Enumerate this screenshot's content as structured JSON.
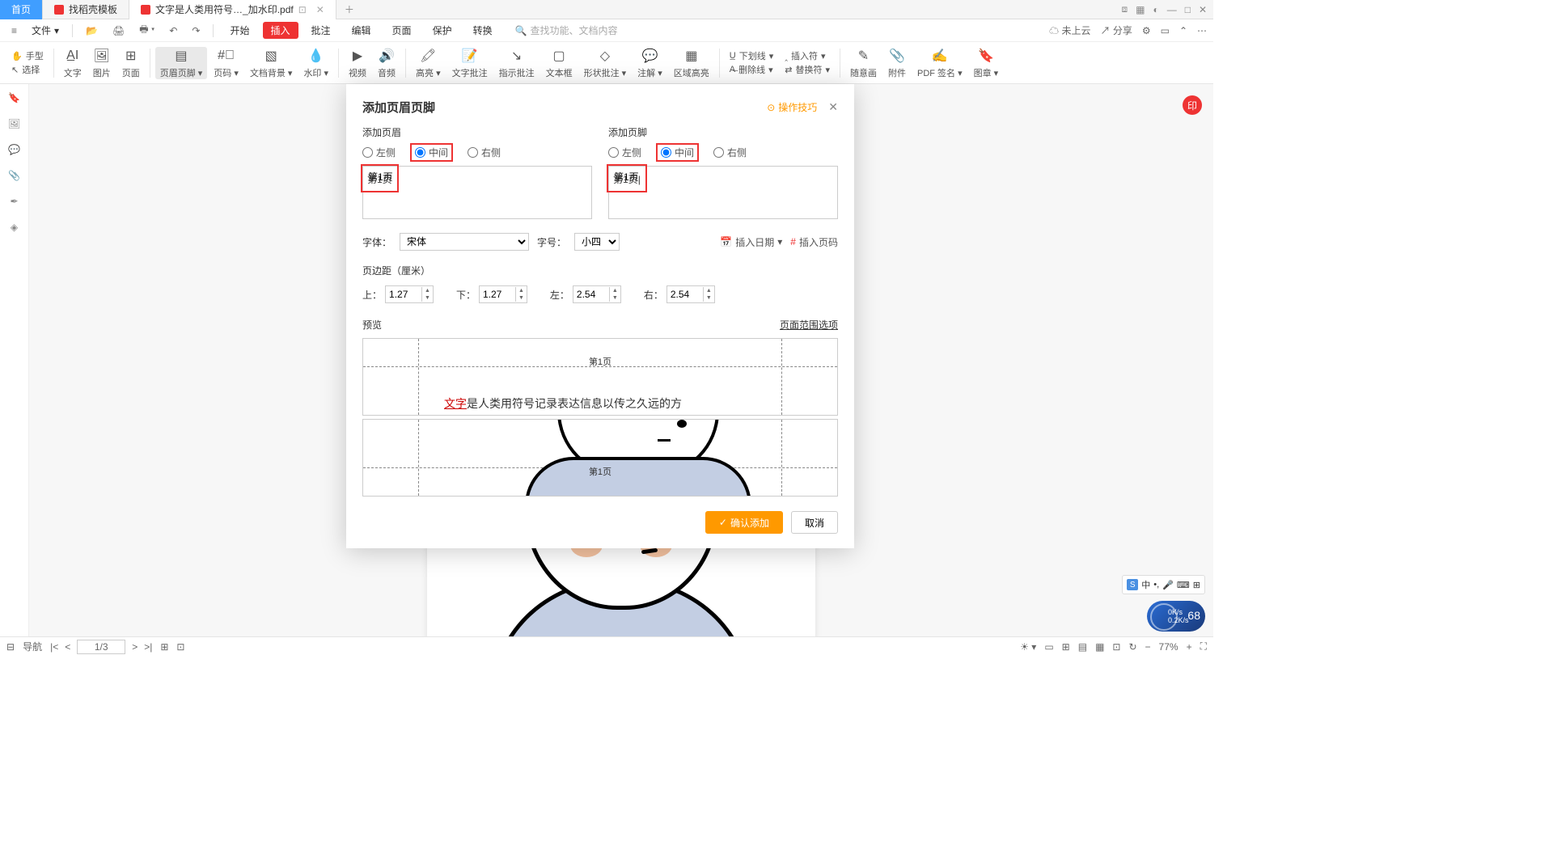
{
  "tabs": {
    "home": "首页",
    "t1": "找稻壳模板",
    "t2": "文字是人类用符号…_加水印.pdf"
  },
  "menu": {
    "file": "文件"
  },
  "ribbon_tabs": [
    "开始",
    "插入",
    "批注",
    "编辑",
    "页面",
    "保护",
    "转换"
  ],
  "search_placeholder": "查找功能、文档内容",
  "topright": {
    "cloud": "未上云",
    "share": "分享"
  },
  "tools_left": {
    "hand": "手型",
    "select": "选择"
  },
  "tools": {
    "text": "文字",
    "image": "图片",
    "page": "页面",
    "hf": "页眉页脚",
    "pageno": "页码",
    "bg": "文档背景",
    "wm": "水印",
    "video": "视频",
    "audio": "音频",
    "hl": "高亮",
    "txtann": "文字批注",
    "finger": "指示批注",
    "txtbox": "文本框",
    "shape": "形状批注",
    "note": "注解",
    "area": "区域高亮",
    "ul": "下划线",
    "del": "删除线",
    "ins": "插入符",
    "rep": "替换符",
    "freehand": "随意画",
    "attach": "附件",
    "sign": "PDF 签名",
    "stamp": "图章"
  },
  "dialog": {
    "title": "添加页眉页脚",
    "tips": "操作技巧",
    "add_header": "添加页眉",
    "add_footer": "添加页脚",
    "left": "左侧",
    "center": "中间",
    "right": "右侧",
    "header_text": "第1页",
    "footer_text": "第1页",
    "font_lbl": "字体：",
    "font_val": "宋体",
    "size_lbl": "字号：",
    "size_val": "小四",
    "insert_date": "插入日期",
    "insert_page": "插入页码",
    "margin_lbl": "页边距（厘米）",
    "m_top": "上：",
    "m_bottom": "下：",
    "m_left": "左：",
    "m_right": "右：",
    "mv_top": "1.27",
    "mv_bottom": "1.27",
    "mv_left": "2.54",
    "mv_right": "2.54",
    "preview_lbl": "预览",
    "range_opt": "页面范围选项",
    "prev_hdr": "第1页",
    "prev_body_red": "文字",
    "prev_body_rest": "是人类用符号记录表达信息以传之久远的方",
    "prev_ftr": "第1页",
    "confirm": "确认添加",
    "cancel": "取消"
  },
  "status": {
    "nav": "导航",
    "page": "1/3",
    "zoom": "77%"
  },
  "os": {
    "net1": "0K/s",
    "net2": "0.2K/s",
    "pct": "68",
    "ime": "中"
  }
}
